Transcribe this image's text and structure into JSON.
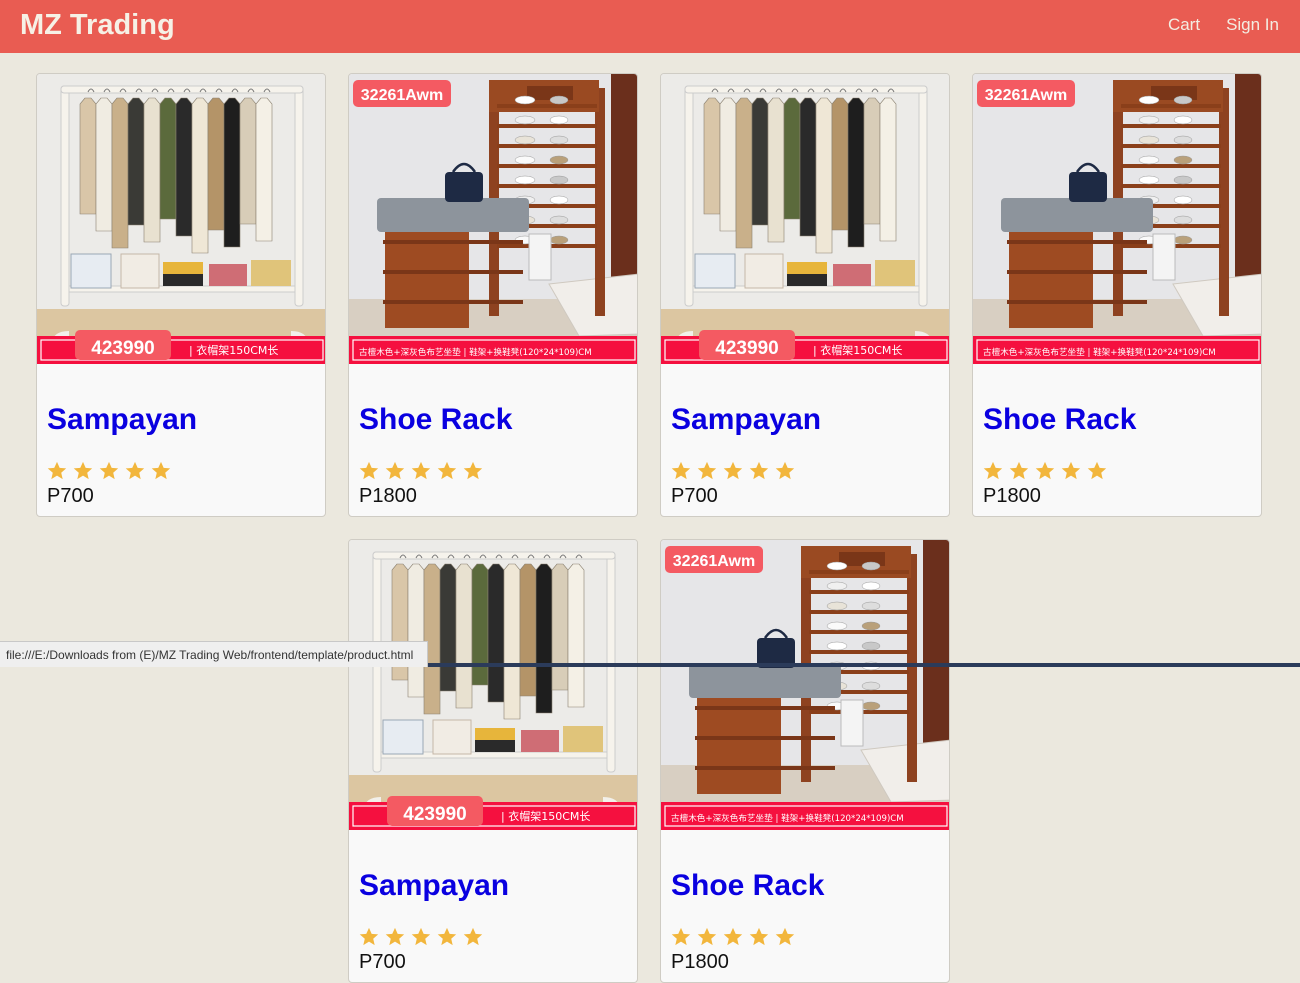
{
  "header": {
    "brand": "MZ Trading",
    "nav": {
      "cart": "Cart",
      "sign_in": "Sign In"
    }
  },
  "products": [
    {
      "title": "Sampayan",
      "price": "P700",
      "rating": 5,
      "image": "clothes-rack",
      "img_code": "423990",
      "img_caption": "衣帽架150CM长"
    },
    {
      "title": "Shoe Rack",
      "price": "P1800",
      "rating": 5,
      "image": "shoe-rack",
      "img_code": "32261Awm",
      "img_caption": "古檀木色+深灰色布艺坐垫 | 鞋架+换鞋凳(120*24*109)CM"
    },
    {
      "title": "Sampayan",
      "price": "P700",
      "rating": 5,
      "image": "clothes-rack",
      "img_code": "423990",
      "img_caption": "衣帽架150CM长"
    },
    {
      "title": "Shoe Rack",
      "price": "P1800",
      "rating": 5,
      "image": "shoe-rack",
      "img_code": "32261Awm",
      "img_caption": "古檀木色+深灰色布艺坐垫 | 鞋架+换鞋凳(120*24*109)CM"
    },
    {
      "title": "Sampayan",
      "price": "P700",
      "rating": 5,
      "image": "clothes-rack",
      "img_code": "423990",
      "img_caption": "衣帽架150CM长"
    },
    {
      "title": "Shoe Rack",
      "price": "P1800",
      "rating": 5,
      "image": "shoe-rack",
      "img_code": "32261Awm",
      "img_caption": "古檀木色+深灰色布艺坐垫 | 鞋架+换鞋凳(120*24*109)CM"
    }
  ],
  "status_bar": {
    "url": "file:///E:/Downloads from (E)/MZ Trading Web/frontend/template/product.html"
  },
  "colors": {
    "header": "#e95c52",
    "background": "#ebe8de",
    "title": "#0a00e0",
    "star": "#f2b63c"
  }
}
